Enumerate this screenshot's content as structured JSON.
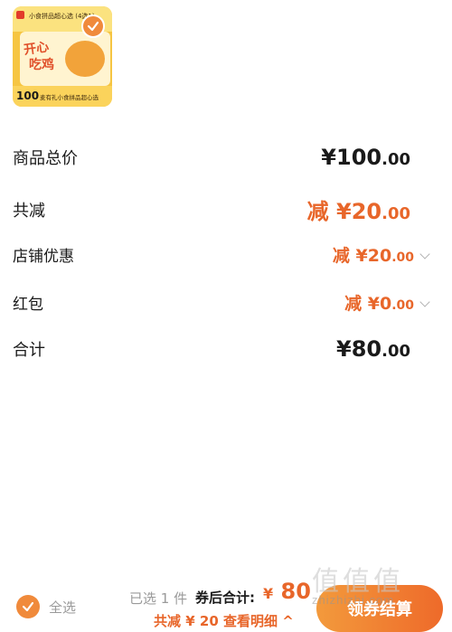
{
  "product": {
    "title": "小食拼品超心选 (4选1)",
    "art_line1": "开心",
    "art_line2": "吃鸡",
    "price_tag": "100",
    "subtitle": "麦有礼小食拼品超心选",
    "checked": true
  },
  "summary": {
    "goods_total": {
      "label": "商品总价",
      "symbol": "¥",
      "int": "100",
      "dec": ".00"
    },
    "total_discount": {
      "label": "共减",
      "prefix": "减",
      "symbol": "¥",
      "int": "20",
      "dec": ".00"
    },
    "shop_discount": {
      "label": "店铺优惠",
      "prefix": "减",
      "symbol": "¥",
      "int": "20",
      "dec": ".00"
    },
    "red_packet": {
      "label": "红包",
      "prefix": "减",
      "symbol": "¥",
      "int": "0",
      "dec": ".00"
    },
    "grand_total": {
      "label": "合计",
      "symbol": "¥",
      "int": "80",
      "dec": ".00"
    }
  },
  "bottom_bar": {
    "select_all_label": "全选",
    "selected_count": "已选 1 件",
    "after_coupon_label": "券后合计:",
    "total_symbol": "¥",
    "total_value": "80",
    "discount_text": "共减 ¥ 20  查看明细 ^",
    "checkout_label": "领券结算"
  },
  "watermark": {
    "big": "值值值",
    "small": "zhizhizhi.com"
  },
  "colors": {
    "accent": "#e8662a",
    "accent_light": "#f08a3b",
    "text": "#1a1a1a",
    "muted": "#9a9a9a"
  }
}
